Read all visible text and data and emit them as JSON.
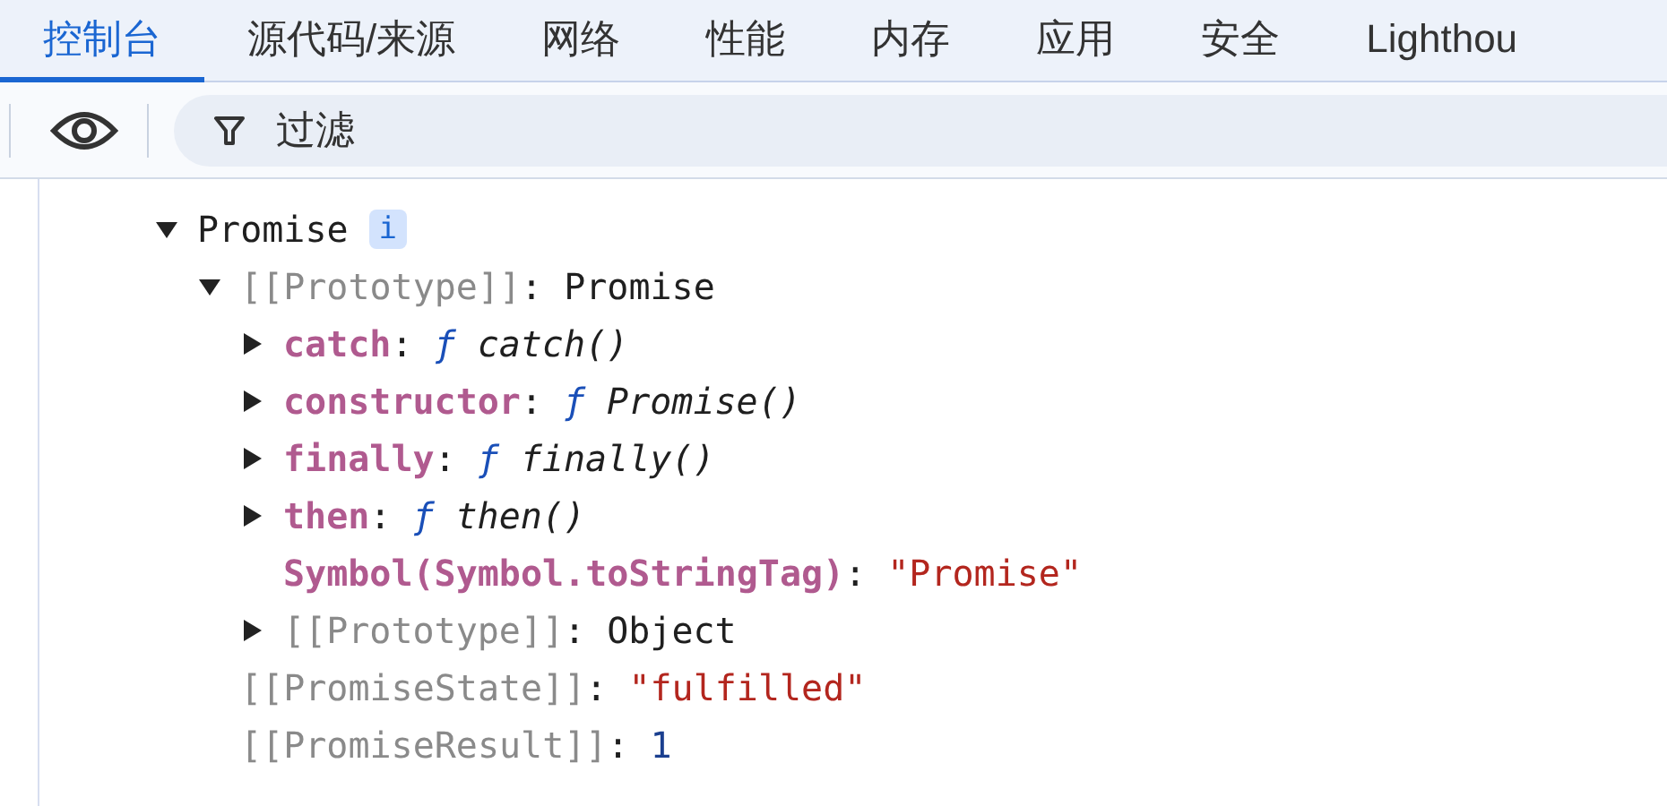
{
  "tabs": [
    {
      "label": "控制台",
      "selected": true
    },
    {
      "label": "源代码/来源",
      "selected": false
    },
    {
      "label": "网络",
      "selected": false
    },
    {
      "label": "性能",
      "selected": false
    },
    {
      "label": "内存",
      "selected": false
    },
    {
      "label": "应用",
      "selected": false
    },
    {
      "label": "安全",
      "selected": false
    },
    {
      "label": "Lighthou",
      "selected": false
    }
  ],
  "filter": {
    "placeholder": "过滤"
  },
  "tree": {
    "label": "Promise",
    "badge": "i",
    "expanded": true,
    "children": [
      {
        "key": "[[Prototype]]",
        "internal": true,
        "separator": ":",
        "value": "Promise",
        "kind": "object",
        "expanded": true,
        "children": [
          {
            "key": "catch",
            "internal": false,
            "separator": ":",
            "func_sign": "ƒ",
            "value": "catch()",
            "kind": "function",
            "expanded": false
          },
          {
            "key": "constructor",
            "internal": false,
            "separator": ":",
            "func_sign": "ƒ",
            "value": "Promise()",
            "kind": "function",
            "expanded": false
          },
          {
            "key": "finally",
            "internal": false,
            "separator": ":",
            "func_sign": "ƒ",
            "value": "finally()",
            "kind": "function",
            "expanded": false
          },
          {
            "key": "then",
            "internal": false,
            "separator": ":",
            "func_sign": "ƒ",
            "value": "then()",
            "kind": "function",
            "expanded": false
          },
          {
            "key": "Symbol(Symbol.toStringTag)",
            "internal": false,
            "separator": ":",
            "value": "\"Promise\"",
            "kind": "string"
          },
          {
            "key": "[[Prototype]]",
            "internal": true,
            "separator": ":",
            "value": "Object",
            "kind": "object",
            "expanded": false
          }
        ]
      },
      {
        "key": "[[PromiseState]]",
        "internal": true,
        "separator": ":",
        "value": "\"fulfilled\"",
        "kind": "string"
      },
      {
        "key": "[[PromiseResult]]",
        "internal": true,
        "separator": ":",
        "value": "1",
        "kind": "number"
      }
    ]
  }
}
